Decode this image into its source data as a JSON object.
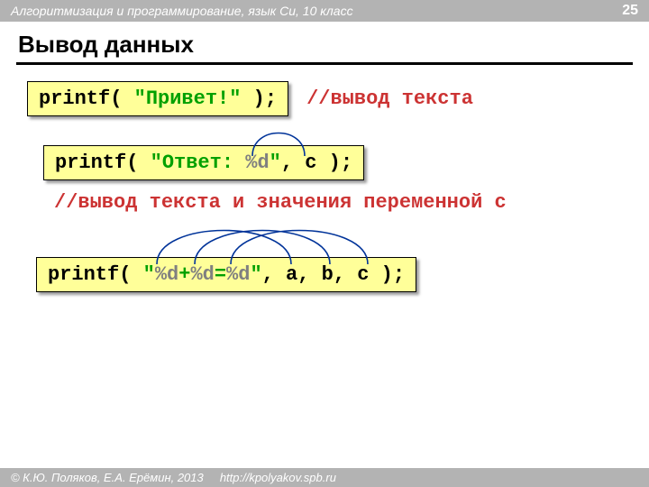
{
  "header": {
    "course": "Алгоритмизация и программирование, язык Си, 10 класс",
    "page": "25"
  },
  "title": "Вывод данных",
  "snippets": {
    "s1": {
      "pre": "printf( ",
      "str": "\"Привет!\"",
      "post": " );",
      "comment": "//вывод текста"
    },
    "s2": {
      "pre": "printf( ",
      "str_a": "\"Ответ: ",
      "fmt": "%d",
      "str_b": "\"",
      "mid": ", c",
      "post": " );",
      "comment": "//вывод текста и значения переменной c"
    },
    "s3": {
      "pre": "printf( ",
      "str_a": "\"",
      "fmt1": "%d",
      "plus1": "+",
      "fmt2": "%d",
      "eq": "=",
      "fmt3": "%d",
      "str_b": "\"",
      "mid": ", a, b, c",
      "post": " );"
    }
  },
  "footer": {
    "copyright": "© К.Ю. Поляков, Е.А. Ерёмин, 2013",
    "url": "http://kpolyakov.spb.ru"
  }
}
